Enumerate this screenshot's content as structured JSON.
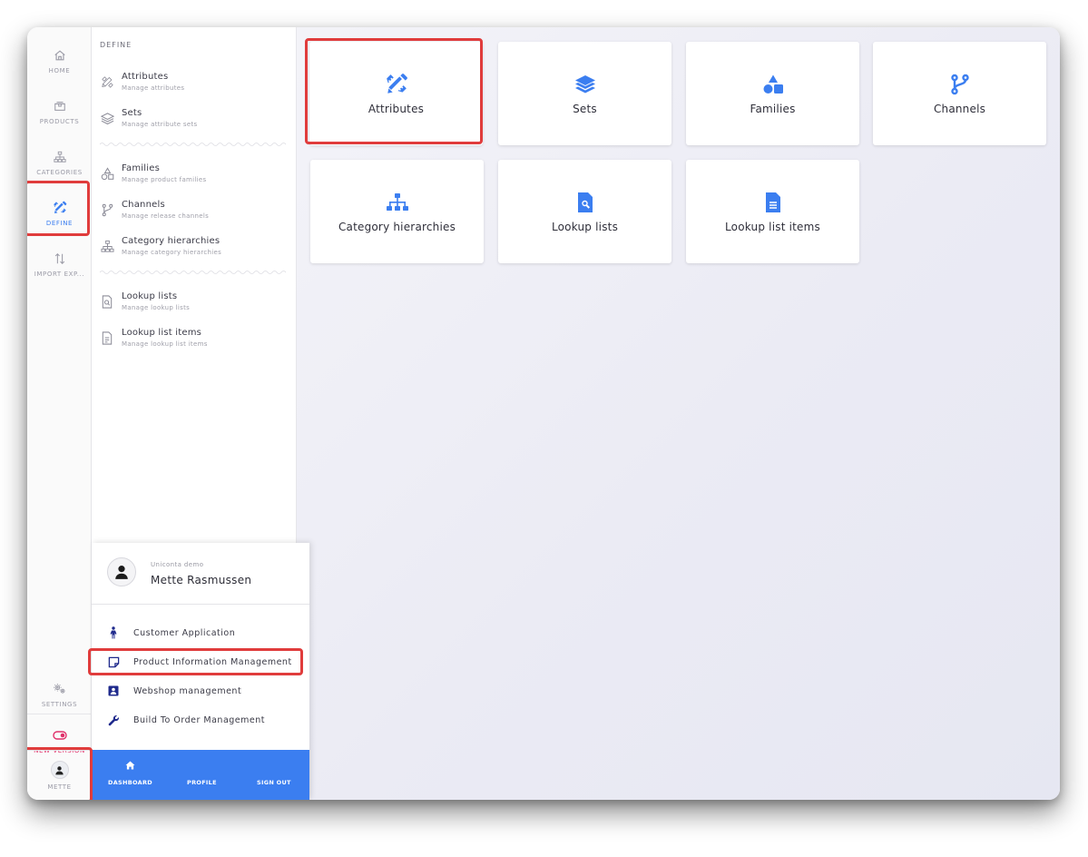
{
  "colors": {
    "accent": "#3b7ef0",
    "highlight": "#e03c3c",
    "new_version": "#e0306a"
  },
  "rail": {
    "items": [
      {
        "label": "HOME",
        "icon": "home-icon"
      },
      {
        "label": "PRODUCTS",
        "icon": "box-icon"
      },
      {
        "label": "CATEGORIES",
        "icon": "hierarchy-icon"
      },
      {
        "label": "DEFINE",
        "icon": "pencil-ruler-icon",
        "active": true
      },
      {
        "label": "IMPORT EXP...",
        "icon": "import-export-icon"
      }
    ],
    "settings_label": "SETTINGS",
    "new_version_label": "NEW VERSION",
    "user_label": "METTE"
  },
  "subnav": {
    "heading": "DEFINE",
    "items": [
      {
        "title": "Attributes",
        "subtitle": "Manage attributes",
        "icon": "pencil-ruler-icon"
      },
      {
        "title": "Sets",
        "subtitle": "Manage attribute sets",
        "icon": "layers-icon"
      },
      {
        "title": "Families",
        "subtitle": "Manage product families",
        "icon": "shapes-icon"
      },
      {
        "title": "Channels",
        "subtitle": "Manage release channels",
        "icon": "branch-icon"
      },
      {
        "title": "Category hierarchies",
        "subtitle": "Manage category hierarchies",
        "icon": "hierarchy-icon"
      },
      {
        "title": "Lookup lists",
        "subtitle": "Manage lookup lists",
        "icon": "file-search-icon"
      },
      {
        "title": "Lookup list items",
        "subtitle": "Manage lookup list items",
        "icon": "file-lines-icon"
      }
    ]
  },
  "cards": [
    {
      "label": "Attributes",
      "icon": "pencil-ruler-icon"
    },
    {
      "label": "Sets",
      "icon": "layers-icon"
    },
    {
      "label": "Families",
      "icon": "shapes-icon"
    },
    {
      "label": "Channels",
      "icon": "branch-icon"
    },
    {
      "label": "Category hierarchies",
      "icon": "hierarchy-icon"
    },
    {
      "label": "Lookup lists",
      "icon": "file-search-icon"
    },
    {
      "label": "Lookup list items",
      "icon": "file-lines-icon"
    }
  ],
  "popup": {
    "org": "Uniconta demo",
    "name": "Mette Rasmussen",
    "apps": [
      {
        "label": "Customer Application",
        "icon": "person-icon"
      },
      {
        "label": "Product Information Management",
        "icon": "sticky-note-icon"
      },
      {
        "label": "Webshop management",
        "icon": "id-badge-icon"
      },
      {
        "label": "Build To Order Management",
        "icon": "wrench-icon"
      }
    ],
    "footer": {
      "dashboard": "DASHBOARD",
      "profile": "PROFILE",
      "sign_out": "SIGN OUT"
    }
  }
}
